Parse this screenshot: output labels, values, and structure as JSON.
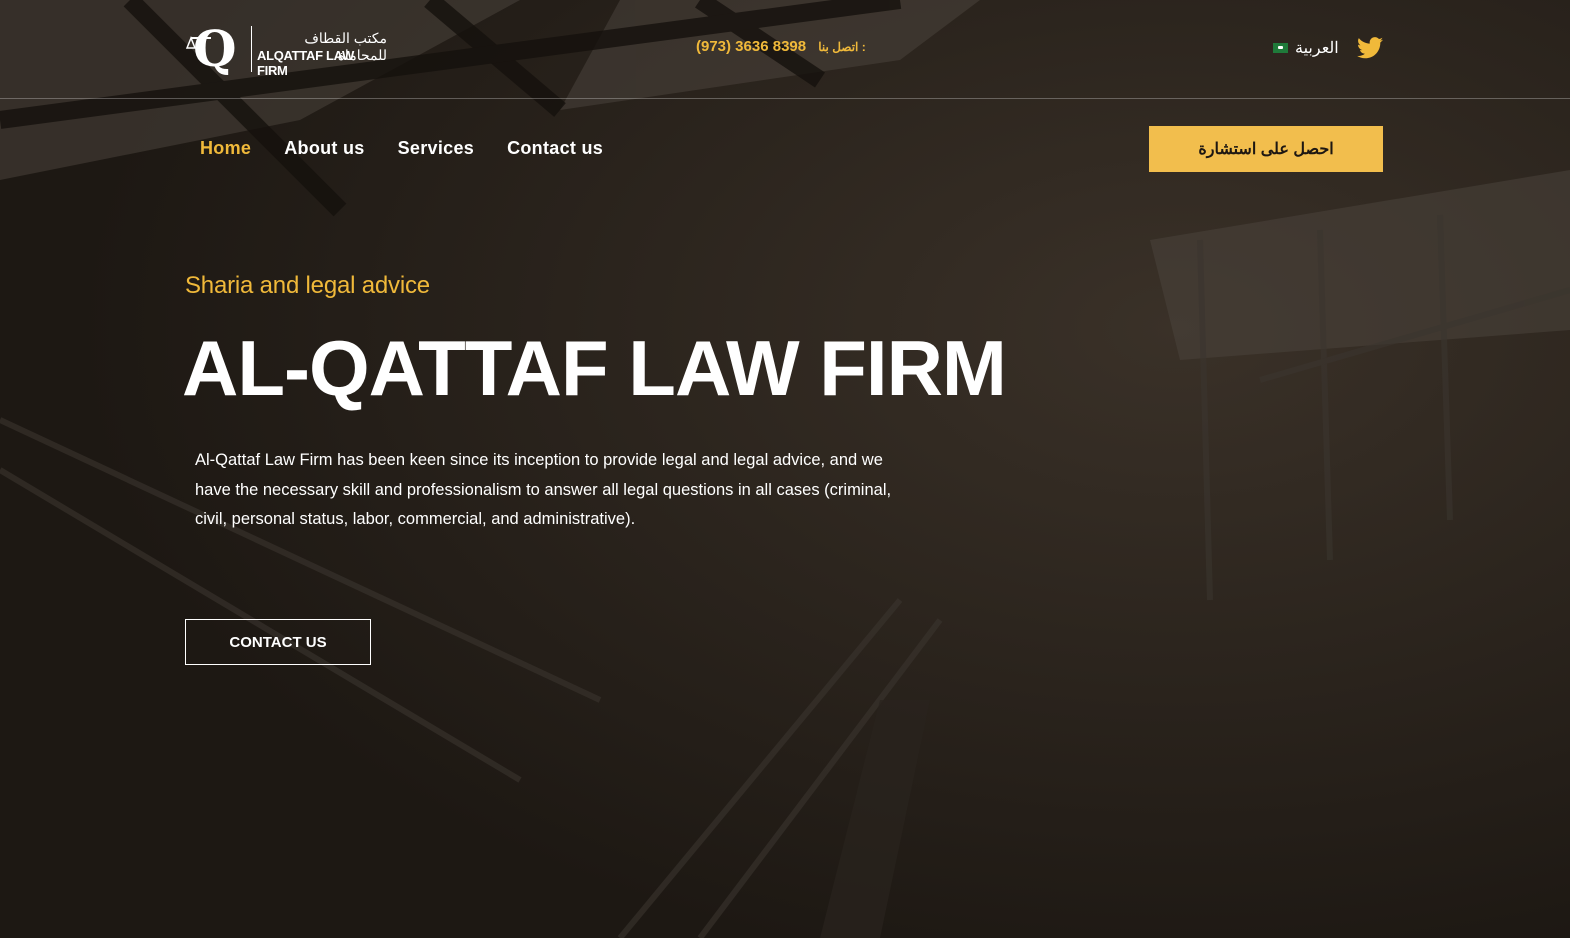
{
  "header": {
    "logo": {
      "arabic": "مكتب القطاف للمحاماة",
      "english": "ALQATTAF LAW FIRM"
    },
    "phone": {
      "label": "اتصل بنا :",
      "number": "(973) 3636 8398"
    },
    "language": "العربية",
    "social_icon": "twitter-icon"
  },
  "nav": {
    "items": [
      {
        "label": "Home",
        "active": true
      },
      {
        "label": "About us",
        "active": false
      },
      {
        "label": "Services",
        "active": false
      },
      {
        "label": "Contact us",
        "active": false
      }
    ],
    "cta_label": "احصل على استشارة"
  },
  "hero": {
    "subtitle": "Sharia and legal advice",
    "title": "AL-QATTAF LAW FIRM",
    "description": "Al-Qattaf Law Firm has been keen since its inception to provide legal and legal advice, and we have the necessary skill and professionalism to answer all legal questions in all cases (criminal, civil, personal status, labor, commercial, and administrative).",
    "button_label": "CONTACT US"
  },
  "colors": {
    "accent": "#f0b93a",
    "button": "#f2be4d",
    "background": "#201a15"
  }
}
